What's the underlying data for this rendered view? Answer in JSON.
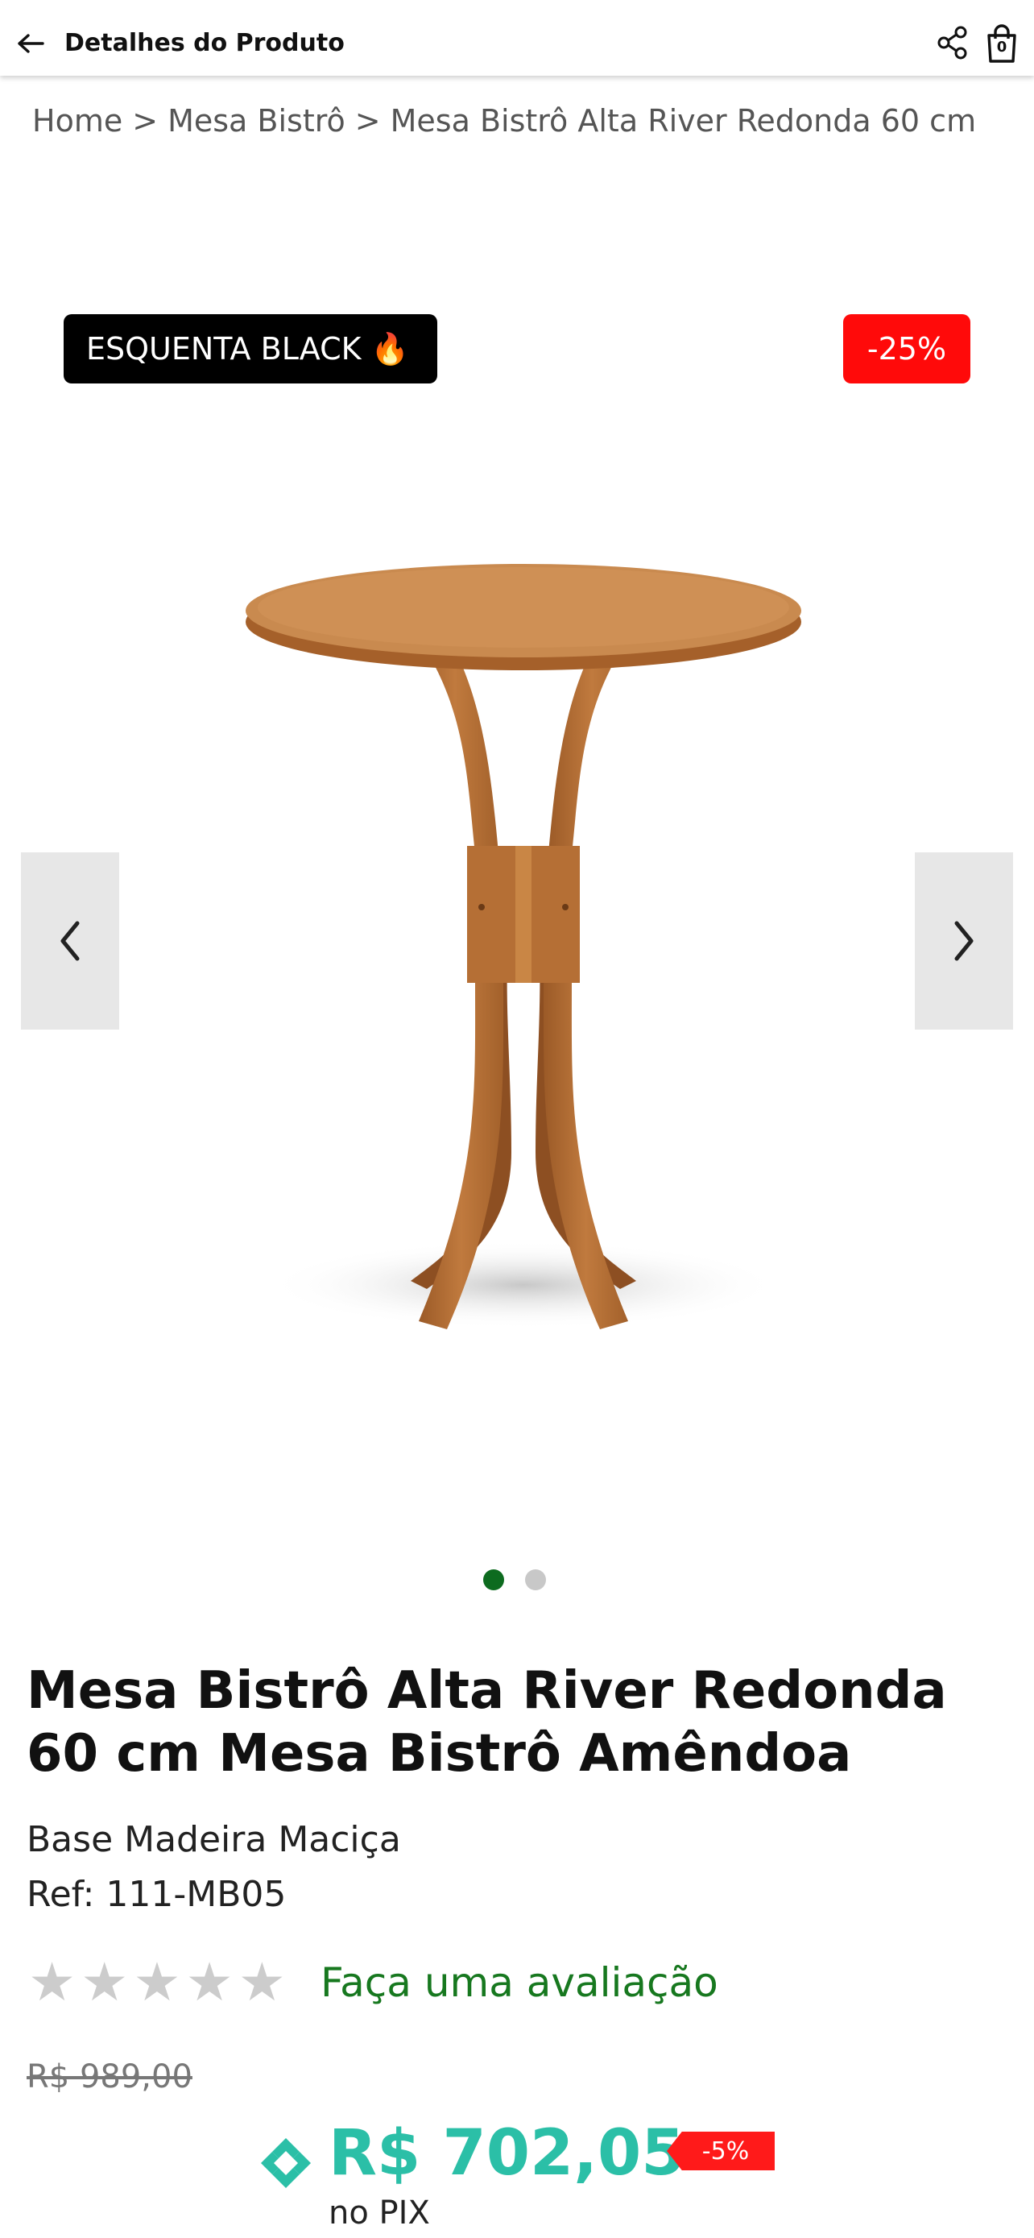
{
  "header": {
    "title": "Detalhes do Produto",
    "cart_count": "0"
  },
  "breadcrumb": [
    "Home",
    "Mesa Bistrô",
    "Mesa Bistrô Alta River Redonda 60 cm"
  ],
  "breadcrumb_separator": ">",
  "badges": {
    "promo": "ESQUENTA BLACK 🔥",
    "discount": "-25%"
  },
  "gallery": {
    "total_images": 2,
    "active_index": 0
  },
  "product": {
    "title": "Mesa Bistrô Alta River Redonda 60 cm Mesa Bistrô Amêndoa",
    "subtitle": "Base Madeira Maciça",
    "ref": "Ref: 111-MB05"
  },
  "rating": {
    "stars": 0,
    "max_stars": 5,
    "review_link": "Faça uma avaliação"
  },
  "pricing": {
    "old_price": "R$ 989,00",
    "pix_price": "R$ 702,05",
    "pix_discount": "-5%",
    "pix_label": "no PIX"
  },
  "colors": {
    "promo_bg": "#000000",
    "discount_red": "#ff0a0a",
    "pix_teal": "#2bbfa7",
    "review_green": "#17781f",
    "dot_active": "#0d6b1f",
    "wood": "#b8733c"
  },
  "icons": {
    "back": "arrow-left-icon",
    "share": "share-icon",
    "cart": "shopping-bag-icon",
    "prev": "chevron-left-icon",
    "next": "chevron-right-icon",
    "pix": "pix-icon",
    "star": "star-icon"
  }
}
